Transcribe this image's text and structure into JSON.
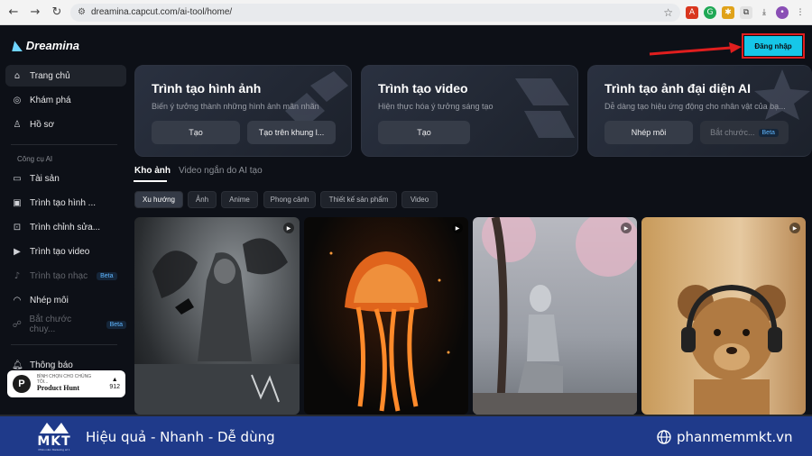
{
  "browser": {
    "url": "dreamina.capcut.com/ai-tool/home/",
    "back_icon": "arrow-left-icon",
    "forward_icon": "arrow-right-icon",
    "reload_icon": "reload-icon"
  },
  "app": {
    "name": "Dreamina",
    "login_label": "Đăng nhập",
    "accent": "#16c7e8",
    "highlight": "#e01e1e"
  },
  "sidebar": {
    "items": [
      {
        "label": "Trang chủ",
        "icon": "home-icon"
      },
      {
        "label": "Khám phá",
        "icon": "compass-icon"
      },
      {
        "label": "Hồ sơ",
        "icon": "user-icon"
      }
    ],
    "section_title": "Công cụ AI",
    "tools": [
      {
        "label": "Tài sản",
        "icon": "folder-icon"
      },
      {
        "label": "Trình tạo hình ...",
        "icon": "image-icon"
      },
      {
        "label": "Trình chỉnh sửa...",
        "icon": "edit-icon"
      },
      {
        "label": "Trình tạo video",
        "icon": "video-icon"
      },
      {
        "label": "Trình tạo nhạc",
        "icon": "music-icon",
        "badge": "Beta"
      },
      {
        "label": "Nhép môi",
        "icon": "lips-icon"
      },
      {
        "label": "Bắt chước chuy...",
        "icon": "motion-icon",
        "badge": "Beta"
      }
    ],
    "notifications": "Thông báo",
    "product_hunt": {
      "small": "BÌNH CHỌN CHO CHÚNG TÔI...",
      "brand": "Product Hunt",
      "count": "912"
    }
  },
  "cards": [
    {
      "title": "Trình tạo hình ảnh",
      "desc": "Biến ý tưởng thành những hình ảnh mãn nhãn",
      "buttons": [
        "Tạo",
        "Tạo trên khung l..."
      ]
    },
    {
      "title": "Trình tạo video",
      "desc": "Hiện thực hóa ý tưởng sáng tạo",
      "buttons": [
        "Tạo"
      ]
    },
    {
      "title": "Trình tạo ảnh đại diện AI",
      "desc": "Dễ dàng tạo hiệu ứng động cho nhân vật của bạ...",
      "buttons": [
        "Nhép môi",
        "Bắt chước..."
      ],
      "badge": "Beta"
    }
  ],
  "tabs": [
    "Kho ảnh",
    "Video ngắn do AI tạo"
  ],
  "filters": [
    "Xu hướng",
    "Ảnh",
    "Anime",
    "Phong cảnh",
    "Thiết kế sản phẩm",
    "Video"
  ],
  "banner": {
    "slogan": "Hiệu quả - Nhanh - Dễ dùng",
    "site": "phanmemmkt.vn",
    "logo": "MKT",
    "logo_sub": "Phần mềm Marketing số 1",
    "bg": "#1f3a8a"
  }
}
